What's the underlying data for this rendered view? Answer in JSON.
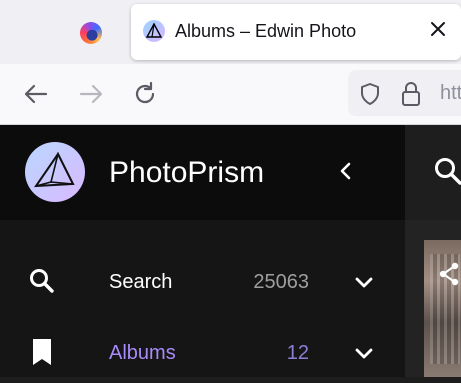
{
  "browser": {
    "active_tab": {
      "title": "Albums – Edwin Photo"
    },
    "url_text": "htt"
  },
  "app": {
    "brand": "PhotoPrism",
    "nav": [
      {
        "label": "Search",
        "count": "25063",
        "icon": "search-icon",
        "label_color": "#ffffff",
        "count_color": "#9e9e9e"
      },
      {
        "label": "Albums",
        "count": "12",
        "icon": "bookmark-icon",
        "label_color": "#a78bfa",
        "count_color": "#8e7fd6"
      }
    ]
  },
  "colors": {
    "accent": "#a78bfa",
    "sidebar_bg": "#151515",
    "header_bg": "#0c0c0c"
  }
}
